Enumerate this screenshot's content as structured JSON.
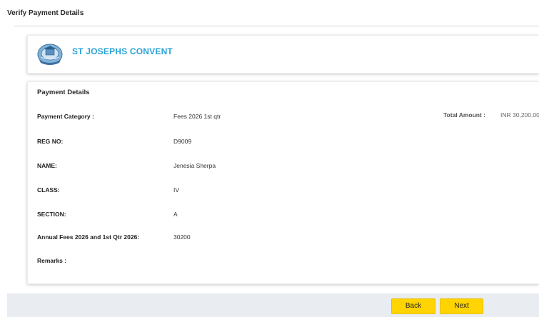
{
  "header": {
    "title": "Verify Payment Details"
  },
  "school": {
    "name": "ST JOSEPHS CONVENT",
    "logo_icon": "school-crest-icon"
  },
  "payment_details": {
    "heading": "Payment Details",
    "fields": [
      {
        "label": "Payment Category :",
        "value": "Fees 2026 1st qtr"
      },
      {
        "label": "REG NO:",
        "value": "D9009"
      },
      {
        "label": "NAME:",
        "value": "Jenesia Sherpa"
      },
      {
        "label": "CLASS:",
        "value": "IV"
      },
      {
        "label": "SECTION:",
        "value": "A"
      },
      {
        "label": "Annual Fees 2026 and 1st Qtr 2026:",
        "value": "30200"
      },
      {
        "label": "Remarks :",
        "value": ""
      }
    ],
    "total_label": "Total Amount :",
    "total_value": "INR 30,200.00"
  },
  "actions": {
    "back_label": "Back",
    "next_label": "Next"
  },
  "colors": {
    "school_name": "#29a3d6",
    "button": "#ffd400",
    "footer": "#e9edf2"
  }
}
